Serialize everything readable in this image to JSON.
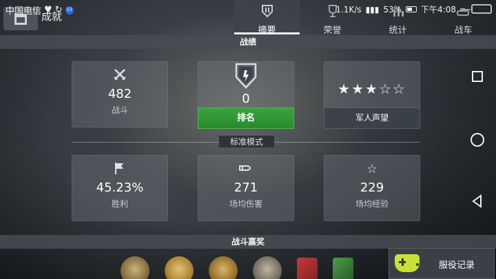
{
  "status_bar": {
    "carrier": "中国电信",
    "badge": "53",
    "network_speed": "1.1K/s",
    "battery": "53%",
    "time": "下午4:08"
  },
  "header": {
    "title": "成就",
    "tabs": [
      {
        "label": "摘要",
        "icon": "summary-shield-icon",
        "active": true
      },
      {
        "label": "荣誉",
        "icon": "trophy-icon",
        "active": false
      },
      {
        "label": "统计",
        "icon": "stats-icon",
        "active": false
      },
      {
        "label": "战车",
        "icon": "tank-icon",
        "active": false
      }
    ]
  },
  "record": {
    "section_title": "战绩",
    "battles": {
      "value": "482",
      "label": "战斗",
      "icon": "crossed-swords-icon"
    },
    "rank": {
      "value": "0",
      "button": "排名",
      "icon": "rank-shield-icon"
    },
    "reputation": {
      "stars": "★★★☆☆",
      "rating": 3,
      "max": 5,
      "button": "军人声望"
    }
  },
  "standard_mode": {
    "label": "标准模式",
    "victories": {
      "value": "45.23%",
      "label": "胜利",
      "icon": "flag-icon"
    },
    "avg_damage": {
      "value": "271",
      "label": "场均伤害",
      "icon": "shell-icon"
    },
    "avg_experience": {
      "value": "229",
      "label": "场均经验",
      "icon": "star-outline-icon"
    }
  },
  "awards": {
    "section_title": "战斗嘉奖",
    "medals": [
      "medal-1",
      "medal-2",
      "medal-3",
      "medal-4",
      "medal-5",
      "medal-6"
    ]
  },
  "service_record": {
    "label": "服役记录",
    "icon": "gamepad-icon"
  },
  "colors": {
    "green_button": "#2f9633",
    "panel": "#6e747a",
    "background": "#2e3439",
    "gamepad": "#c9df3a"
  }
}
